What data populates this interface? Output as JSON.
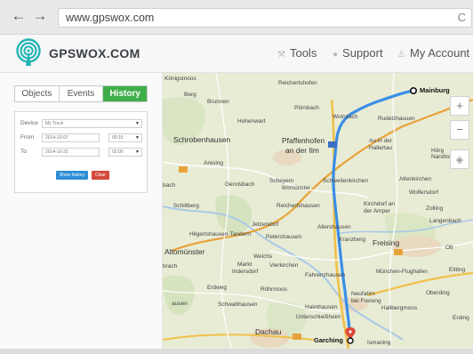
{
  "browser": {
    "back_icon": "←",
    "forward_icon": "→",
    "url": "www.gpswox.com",
    "reload_icon": "C"
  },
  "header": {
    "brand": "GPSWOX.COM",
    "menu": [
      {
        "label": "Tools",
        "icon": "wrench-icon"
      },
      {
        "label": "Support",
        "icon": "support-icon"
      },
      {
        "label": "My Account",
        "icon": "user-icon"
      }
    ]
  },
  "panel": {
    "tabs": [
      {
        "label": "Objects",
        "active": false
      },
      {
        "label": "Events",
        "active": false
      },
      {
        "label": "History",
        "active": true
      }
    ],
    "form": {
      "device_label": "Device",
      "device_value": "My Truck",
      "from_label": "From",
      "from_date": "2014-10-07",
      "from_time": "00:15",
      "to_label": "To",
      "to_date": "2014-10-31",
      "to_time": "02:00",
      "show_history": "Show history",
      "clear": "Clear"
    }
  },
  "map": {
    "zoom_in": "+",
    "zoom_out": "−",
    "route_color": "#3a8ee6",
    "places": {
      "mainburg": "Mainburg",
      "garching": "Garching",
      "koenigsmoos": "Königsmoos",
      "reichertshofen": "Reichertshofen",
      "berg": "Berg",
      "brunnen": "Brunnen",
      "pornbach": "Pörnbach",
      "hohenwart": "Hohenwart",
      "schrobenhausen": "Schrobenhausen",
      "aresing": "Aresing",
      "pfaffenhofen": "Pfaffenhofen",
      "an_der_ilm": "an der Ilm",
      "wolnzach": "Wolnzach",
      "rudelzhausen": "Rudelzhausen",
      "au": "Au in der",
      "hallertau": "Hallertau",
      "hoerg": "Hörg",
      "nandlstadt": "Nandlstadt",
      "gerolsbach": "Gerolsbach",
      "scheyern": "Scheyern",
      "ilmmuenster": "Ilmmünster",
      "schweitenkirchen": "Schweitenkirchen",
      "attenkirchen": "Attenkirchen",
      "wolfersdorf": "Wolfersdorf",
      "schiltberg": "Schiltberg",
      "reichertshausen": "Reichertshausen",
      "kirchdorf": "Kirchdorf an",
      "der_amper": "der Amper",
      "zolling": "Zolling",
      "langenbach": "Langenbach",
      "jetzendorf": "Jetzendorf",
      "hilgertshausen": "Hilgertshausen-Tandern",
      "petershausen": "Petershausen",
      "allershausen": "Allershausen",
      "kranzberg": "Kranzberg",
      "freising": "Freising",
      "altomuenster": "Altomünster",
      "weichs": "Weichs",
      "markt": "Markt",
      "indersdorf": "Indersdorf",
      "vierkirchen": "Vierkirchen",
      "fahrenzhausen": "Fahrenzhausen",
      "erdweg": "Erdweg",
      "roehrmoos": "Röhrmoos",
      "neufahrn": "Neufahrn",
      "bei_freising": "bei Freising",
      "hallbergmoos": "Hallbergmoos",
      "moenchen": "München-Flughafen",
      "eitting": "Eitting",
      "oberding": "Oberding",
      "erding": "Erding",
      "schwabhausen": "Schwabhausen",
      "haimhausen": "Haimhausen",
      "unterschleissheim": "Unterschleißheim",
      "dachau": "Dachau",
      "ismaning": "Ismaning",
      "brach": "brach",
      "bach": "bach",
      "ott": "Ott",
      "fahrenzhausen_short": "ausen",
      "ob": "Ob"
    }
  }
}
